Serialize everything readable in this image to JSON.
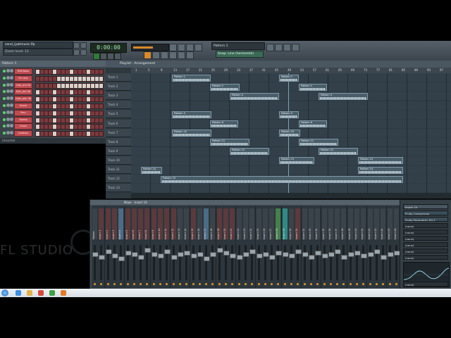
{
  "window": {
    "file_title": "sand_(patmusic.flp",
    "hint_text": "Zoom level: 12"
  },
  "toolbar": {
    "time_display": "0:00:00",
    "pattern_selector": "Pattern 1",
    "layout_selector": "Snap: Line (horizontal)"
  },
  "channel_rack": {
    "title": "Pattern 1",
    "footer": "Unsorted",
    "channels": [
      {
        "name": "808 Bass"
      },
      {
        "name": "Fa Lady"
      },
      {
        "name": "Clap_ard 2b"
      },
      {
        "name": "Kick_ard 4b"
      },
      {
        "name": "Hats_pen 3b"
      },
      {
        "name": "Snare"
      },
      {
        "name": "Perc"
      },
      {
        "name": "Sweep"
      },
      {
        "name": "Crash"
      },
      {
        "name": "Leadvox"
      }
    ]
  },
  "playlist": {
    "title": "Playlist - Arrangement",
    "ruler": [
      "1",
      "5",
      "9",
      "13",
      "17",
      "21",
      "25",
      "29",
      "33",
      "37",
      "41",
      "45",
      "49",
      "53",
      "57",
      "61",
      "65",
      "69",
      "73",
      "77",
      "81",
      "85",
      "89",
      "93",
      "97"
    ],
    "tracks": [
      "Track 1",
      "Track 2",
      "Track 3",
      "Track 4",
      "Track 5",
      "Track 6",
      "Track 7",
      "Track 8",
      "Track 9",
      "Track 10",
      "Track 11",
      "Track 12",
      "Track 13"
    ],
    "clips": [
      {
        "track": 0,
        "start": 58,
        "len": 55,
        "label": "Pattern 1"
      },
      {
        "track": 0,
        "start": 210,
        "len": 28,
        "label": "Pattern 1"
      },
      {
        "track": 1,
        "start": 112,
        "len": 42,
        "label": "Pattern 2"
      },
      {
        "track": 1,
        "start": 238,
        "len": 40,
        "label": "Pattern 2"
      },
      {
        "track": 2,
        "start": 140,
        "len": 70,
        "label": "Pattern 4"
      },
      {
        "track": 2,
        "start": 266,
        "len": 70,
        "label": "Pattern 4"
      },
      {
        "track": 4,
        "start": 58,
        "len": 56,
        "label": "Pattern 5"
      },
      {
        "track": 4,
        "start": 210,
        "len": 28,
        "label": "Pattern 5"
      },
      {
        "track": 5,
        "start": 112,
        "len": 40,
        "label": "Pattern 6"
      },
      {
        "track": 5,
        "start": 238,
        "len": 40,
        "label": "Pattern 6"
      },
      {
        "track": 6,
        "start": 58,
        "len": 56,
        "label": "Pattern 10"
      },
      {
        "track": 6,
        "start": 210,
        "len": 30,
        "label": "Pattern 10"
      },
      {
        "track": 7,
        "start": 112,
        "len": 56,
        "label": "Pattern 11"
      },
      {
        "track": 7,
        "start": 238,
        "len": 56,
        "label": "Pattern 11"
      },
      {
        "track": 8,
        "start": 140,
        "len": 56,
        "label": "Pattern 12"
      },
      {
        "track": 8,
        "start": 266,
        "len": 56,
        "label": "Pattern 12"
      },
      {
        "track": 9,
        "start": 210,
        "len": 50,
        "label": "Pattern 13"
      },
      {
        "track": 9,
        "start": 322,
        "len": 64,
        "label": "Pattern 13"
      },
      {
        "track": 10,
        "start": 14,
        "len": 30,
        "label": "Pattern 14"
      },
      {
        "track": 10,
        "start": 322,
        "len": 64,
        "label": "Pattern 14"
      },
      {
        "track": 11,
        "start": 42,
        "len": 344,
        "label": "Pattern 15"
      }
    ]
  },
  "mixer": {
    "title": "Mixer - Insert 19",
    "strips": [
      {
        "name": "Master",
        "style": "plain"
      },
      {
        "name": "Insert 1",
        "style": "red"
      },
      {
        "name": "Insert 2",
        "style": "red"
      },
      {
        "name": "Insert 3",
        "style": "red"
      },
      {
        "name": "Insert 4",
        "style": "blue"
      },
      {
        "name": "Insert 5",
        "style": "red"
      },
      {
        "name": "Insert 6",
        "style": "red"
      },
      {
        "name": "Insert 7",
        "style": "red"
      },
      {
        "name": "Insert 8",
        "style": "red"
      },
      {
        "name": "Insert 9",
        "style": "red"
      },
      {
        "name": "Insert 10",
        "style": "red"
      },
      {
        "name": "Insert 11",
        "style": "red"
      },
      {
        "name": "Insert 12",
        "style": "red"
      },
      {
        "name": "Insert 13",
        "style": "plain"
      },
      {
        "name": "Insert 14",
        "style": "plain"
      },
      {
        "name": "Insert 15",
        "style": "red"
      },
      {
        "name": "Insert 16",
        "style": "plain"
      },
      {
        "name": "Insert 17",
        "style": "blue"
      },
      {
        "name": "Insert 18",
        "style": "plain"
      },
      {
        "name": "Insert 19",
        "style": "red"
      },
      {
        "name": "Insert 20",
        "style": "red"
      },
      {
        "name": "Insert 21",
        "style": "red"
      },
      {
        "name": "Insert 22",
        "style": "plain"
      },
      {
        "name": "Insert 23",
        "style": "plain"
      },
      {
        "name": "Insert 24",
        "style": "plain"
      },
      {
        "name": "Insert 25",
        "style": "plain"
      },
      {
        "name": "Insert 26",
        "style": "plain"
      },
      {
        "name": "Insert 27",
        "style": "plain"
      },
      {
        "name": "Insert 28",
        "style": "green"
      },
      {
        "name": "Insert 29",
        "style": "teal"
      },
      {
        "name": "Insert 30",
        "style": "plain"
      },
      {
        "name": "Insert 31",
        "style": "red"
      },
      {
        "name": "Insert 32",
        "style": "plain"
      },
      {
        "name": "Insert 33",
        "style": "plain"
      },
      {
        "name": "Insert 34",
        "style": "plain"
      },
      {
        "name": "Insert 35",
        "style": "plain"
      },
      {
        "name": "Insert 36",
        "style": "plain"
      },
      {
        "name": "Insert 37",
        "style": "plain"
      },
      {
        "name": "Insert 38",
        "style": "plain"
      },
      {
        "name": "Insert 39",
        "style": "plain"
      },
      {
        "name": "Insert 40",
        "style": "plain"
      },
      {
        "name": "Insert 41",
        "style": "plain"
      },
      {
        "name": "Insert 42",
        "style": "plain"
      },
      {
        "name": "Insert 43",
        "style": "plain"
      },
      {
        "name": "Insert 44",
        "style": "plain"
      },
      {
        "name": "Insert 45",
        "style": "plain"
      },
      {
        "name": "Insert 46",
        "style": "plain"
      }
    ]
  },
  "fx": {
    "header": "Insert 19",
    "slots": [
      {
        "label": "Fruity Compressor",
        "on": true
      },
      {
        "label": "Fruity Parametric EQ 2",
        "on": true
      },
      {
        "label": "(none)",
        "on": false
      },
      {
        "label": "(none)",
        "on": false
      },
      {
        "label": "(none)",
        "on": false
      },
      {
        "label": "(none)",
        "on": false
      },
      {
        "label": "(none)",
        "on": false
      },
      {
        "label": "(none)",
        "on": false
      }
    ],
    "footer": "(none)"
  },
  "watermark": "FL STUDIO",
  "colors": {
    "accent": "#3a9c58",
    "channel": "#c04c52",
    "clip": "#4a5e6a"
  }
}
